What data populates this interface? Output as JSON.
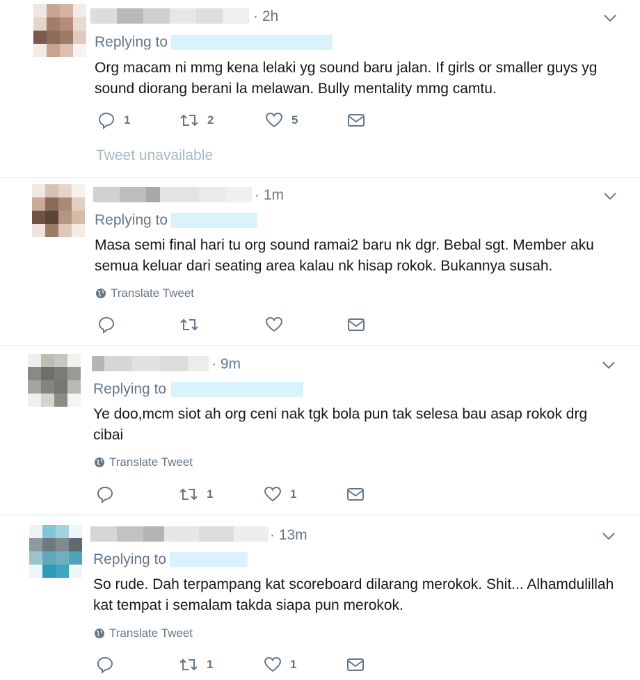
{
  "tweets": [
    {
      "time": "· 2h",
      "replying": "Replying to",
      "text": [
        "Org macam ni mmg kena lelaki yg sound baru jalan. If girls or smaller guys yg",
        "sound diorang berani la melawan. Bully mentality mmg camtu."
      ],
      "translate": "",
      "replies": "1",
      "retweets": "2",
      "likes": "5"
    },
    {
      "time": "· 1m",
      "replying": "Replying to",
      "text": [
        "Masa semi final hari tu org sound ramai2 baru nk dgr. Bebal sgt. Member aku",
        "semua keluar dari seating area kalau nk hisap rokok. Bukannya susah."
      ],
      "translate": "Translate Tweet",
      "replies": "",
      "retweets": "",
      "likes": ""
    },
    {
      "time": "· 9m",
      "replying": "Replying to",
      "text": [
        "Ye doo,mcm siot ah org ceni nak tgk bola pun tak selesa bau asap rokok drg",
        "cibai"
      ],
      "translate": "Translate Tweet",
      "replies": "",
      "retweets": "1",
      "likes": "1"
    },
    {
      "time": "· 13m",
      "replying": "Replying to",
      "text": [
        "So rude. Dah terpampang kat scoreboard dilarang merokok. Shit... Alhamdulillah",
        "kat tempat i semalam takda siapa pun merokok."
      ],
      "translate": "Translate Tweet",
      "replies": "",
      "retweets": "1",
      "likes": "1"
    }
  ],
  "unavailable": "Tweet unavailable",
  "icons": {
    "reply": "reply-icon",
    "retweet": "retweet-icon",
    "like": "heart-icon",
    "dm": "envelope-icon",
    "more": "chevron-down-icon",
    "globe": "globe-icon"
  },
  "colors": {
    "muted": "#657786",
    "text": "#14171a",
    "unavailable": "#aab8c2"
  }
}
